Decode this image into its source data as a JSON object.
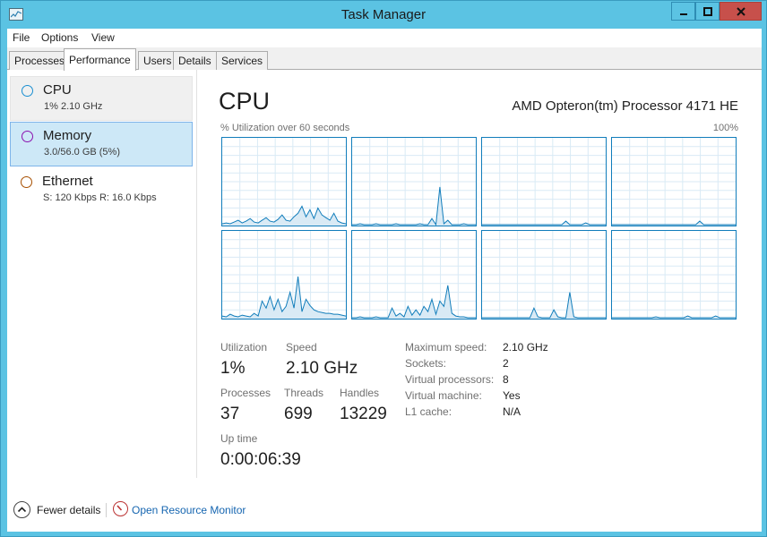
{
  "window": {
    "title": "Task Manager",
    "accent": "#5bc3e3",
    "close_color": "#c7504b"
  },
  "menu": [
    "File",
    "Options",
    "View"
  ],
  "tabs": [
    {
      "label": "Processes",
      "active": false
    },
    {
      "label": "Performance",
      "active": true
    },
    {
      "label": "Users",
      "active": false
    },
    {
      "label": "Details",
      "active": false
    },
    {
      "label": "Services",
      "active": false
    }
  ],
  "sidebar": {
    "items": [
      {
        "title": "CPU",
        "subtitle": "1% 2.10 GHz",
        "color": "#1a8fd1",
        "state": "hover"
      },
      {
        "title": "Memory",
        "subtitle": "3.0/56.0 GB (5%)",
        "color": "#8b12ae",
        "state": "selected"
      },
      {
        "title": "Ethernet",
        "subtitle": "S: 120 Kbps R: 16.0 Kbps",
        "color": "#a74f01",
        "state": "normal"
      }
    ]
  },
  "cpu": {
    "heading": "CPU",
    "processor": "AMD Opteron(tm) Processor 4171 HE",
    "util_label": "% Utilization over 60 seconds",
    "util_max": "100%",
    "graph_color": "#117dbb",
    "graph_fill": "#d9eaf5",
    "grid_color": "#d9eaf5",
    "core_graphs": [
      [
        2,
        3,
        2,
        4,
        6,
        3,
        5,
        8,
        4,
        3,
        6,
        9,
        5,
        4,
        7,
        12,
        6,
        5,
        10,
        14,
        22,
        10,
        18,
        8,
        20,
        12,
        9,
        6,
        14,
        5,
        3,
        2
      ],
      [
        1,
        1,
        2,
        1,
        1,
        1,
        2,
        1,
        1,
        1,
        1,
        2,
        1,
        1,
        1,
        1,
        1,
        2,
        1,
        1,
        8,
        1,
        44,
        2,
        6,
        1,
        1,
        1,
        2,
        1,
        1,
        1
      ],
      [
        1,
        1,
        1,
        1,
        1,
        1,
        1,
        1,
        1,
        1,
        1,
        1,
        1,
        1,
        1,
        1,
        1,
        1,
        1,
        1,
        1,
        5,
        1,
        1,
        1,
        1,
        3,
        1,
        1,
        1,
        1,
        1
      ],
      [
        1,
        1,
        1,
        1,
        1,
        1,
        1,
        1,
        1,
        1,
        1,
        1,
        1,
        1,
        1,
        1,
        1,
        1,
        1,
        1,
        1,
        1,
        5,
        1,
        1,
        1,
        1,
        1,
        1,
        1,
        1,
        1
      ],
      [
        3,
        2,
        5,
        3,
        2,
        4,
        3,
        2,
        6,
        3,
        20,
        12,
        25,
        10,
        22,
        8,
        14,
        30,
        12,
        48,
        8,
        22,
        15,
        10,
        8,
        7,
        6,
        6,
        5,
        5,
        4,
        3
      ],
      [
        1,
        1,
        2,
        1,
        1,
        1,
        2,
        1,
        1,
        1,
        12,
        3,
        6,
        2,
        14,
        4,
        10,
        4,
        14,
        8,
        22,
        5,
        20,
        14,
        38,
        6,
        3,
        2,
        2,
        1,
        1,
        1
      ],
      [
        1,
        1,
        1,
        1,
        1,
        1,
        1,
        1,
        1,
        1,
        1,
        1,
        1,
        12,
        2,
        1,
        1,
        1,
        10,
        2,
        1,
        1,
        30,
        2,
        1,
        1,
        1,
        1,
        1,
        1,
        1,
        1
      ],
      [
        1,
        1,
        1,
        1,
        1,
        1,
        1,
        1,
        1,
        1,
        1,
        2,
        1,
        1,
        1,
        1,
        1,
        1,
        1,
        3,
        1,
        1,
        1,
        1,
        1,
        1,
        3,
        1,
        1,
        1,
        1,
        1
      ]
    ],
    "stats": {
      "utilization_label": "Utilization",
      "utilization": "1%",
      "speed_label": "Speed",
      "speed": "2.10 GHz",
      "processes_label": "Processes",
      "processes": "37",
      "threads_label": "Threads",
      "threads": "699",
      "handles_label": "Handles",
      "handles": "13229",
      "uptime_label": "Up time",
      "uptime": "0:00:06:39"
    },
    "details": [
      {
        "key": "Maximum speed:",
        "value": "2.10 GHz"
      },
      {
        "key": "Sockets:",
        "value": "2"
      },
      {
        "key": "Virtual processors:",
        "value": "8"
      },
      {
        "key": "Virtual machine:",
        "value": "Yes"
      },
      {
        "key": "L1 cache:",
        "value": "N/A"
      }
    ]
  },
  "footer": {
    "fewer_details": "Fewer details",
    "open_resource_monitor": "Open Resource Monitor"
  }
}
